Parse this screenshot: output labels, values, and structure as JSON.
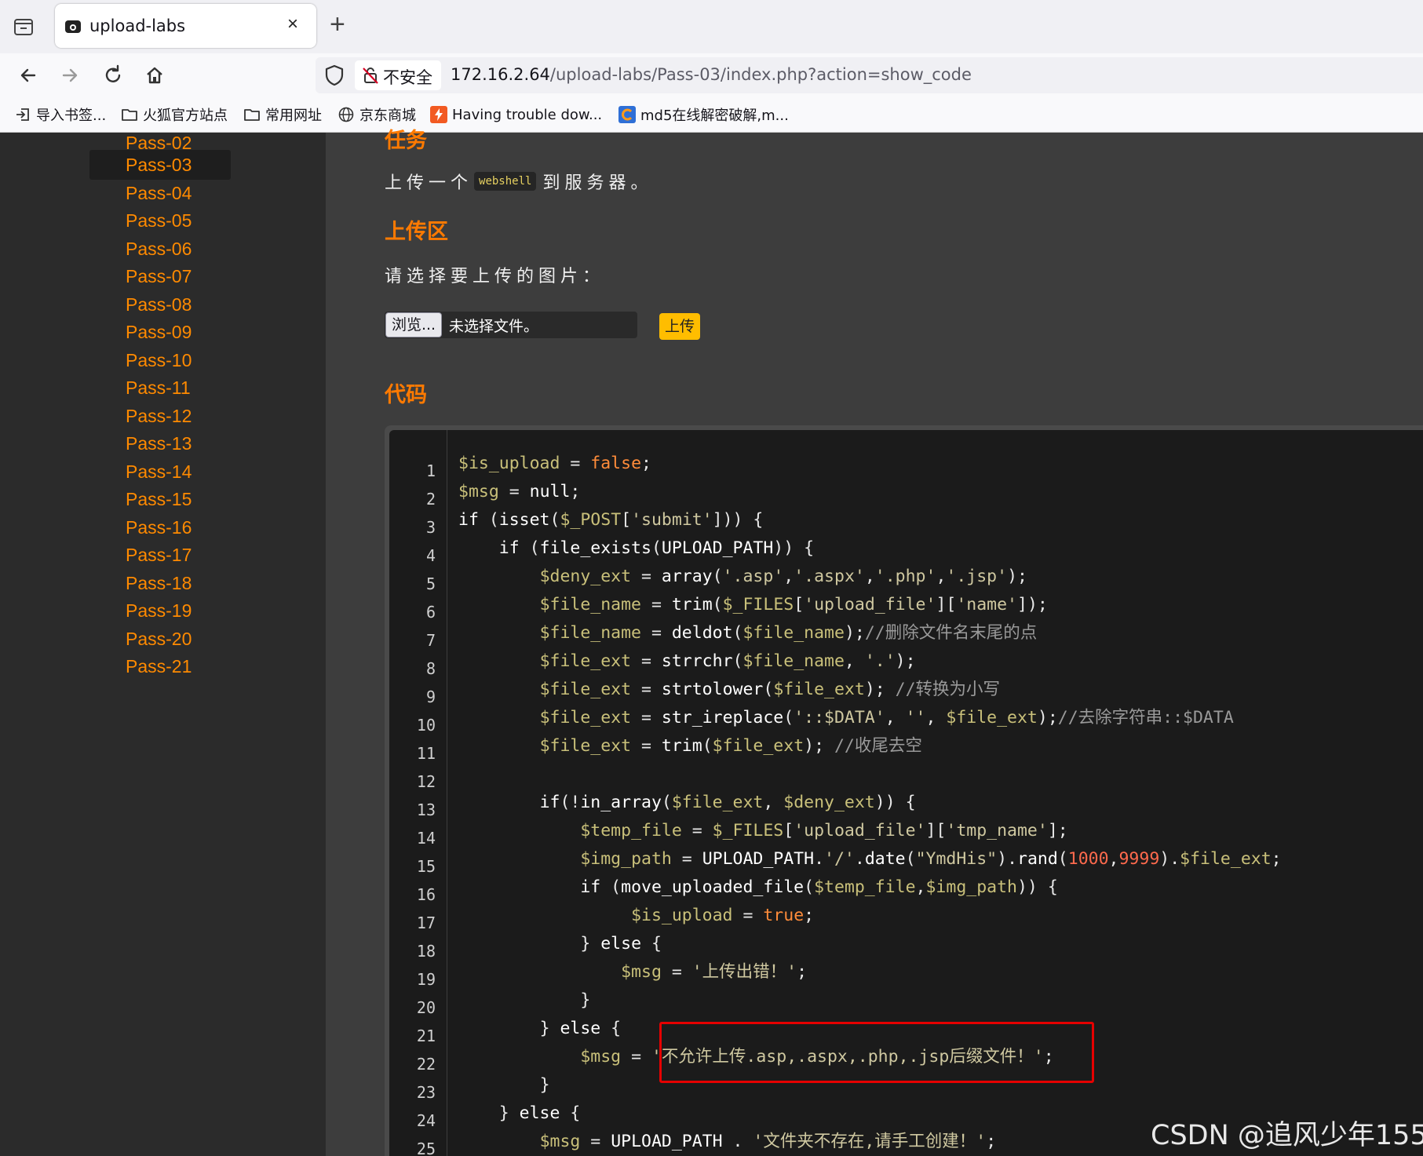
{
  "browser": {
    "tab_title": "upload-labs",
    "tab_close": "×",
    "new_tab": "+",
    "insecure_label": "不安全",
    "url_host": "172.16.2.64",
    "url_path": "/upload-labs/Pass-03/index.php?action=show_code",
    "bookmarks": [
      "导入书签...",
      "火狐官方站点",
      "常用网址",
      "京东商城",
      "Having trouble dow...",
      "md5在线解密破解,m..."
    ]
  },
  "sidebar": {
    "items": [
      "Pass-02",
      "Pass-03",
      "Pass-04",
      "Pass-05",
      "Pass-06",
      "Pass-07",
      "Pass-08",
      "Pass-09",
      "Pass-10",
      "Pass-11",
      "Pass-12",
      "Pass-13",
      "Pass-14",
      "Pass-15",
      "Pass-16",
      "Pass-17",
      "Pass-18",
      "Pass-19",
      "Pass-20",
      "Pass-21"
    ],
    "active": "Pass-03"
  },
  "main": {
    "task_heading": "任务",
    "task_before": "上传一个",
    "task_code": "webshell",
    "task_after": "到服务器。",
    "upload_heading": "上传区",
    "choose_label": "请选择要上传的图片：",
    "browse_label": "浏览...",
    "no_file_label": "未选择文件。",
    "upload_label": "上传",
    "code_heading": "代码"
  },
  "code": {
    "line_numbers": [
      "1",
      "2",
      "3",
      "4",
      "5",
      "6",
      "7",
      "8",
      "9",
      "10",
      "11",
      "12",
      "13",
      "14",
      "15",
      "16",
      "17",
      "18",
      "19",
      "20",
      "21",
      "22",
      "23",
      "24",
      "25"
    ]
  },
  "watermark": "CSDN @追风少年155",
  "colors": {
    "accent_orange": "#ff7a00",
    "upload_button": "#ffbd00",
    "highlight_box": "#e60000"
  }
}
